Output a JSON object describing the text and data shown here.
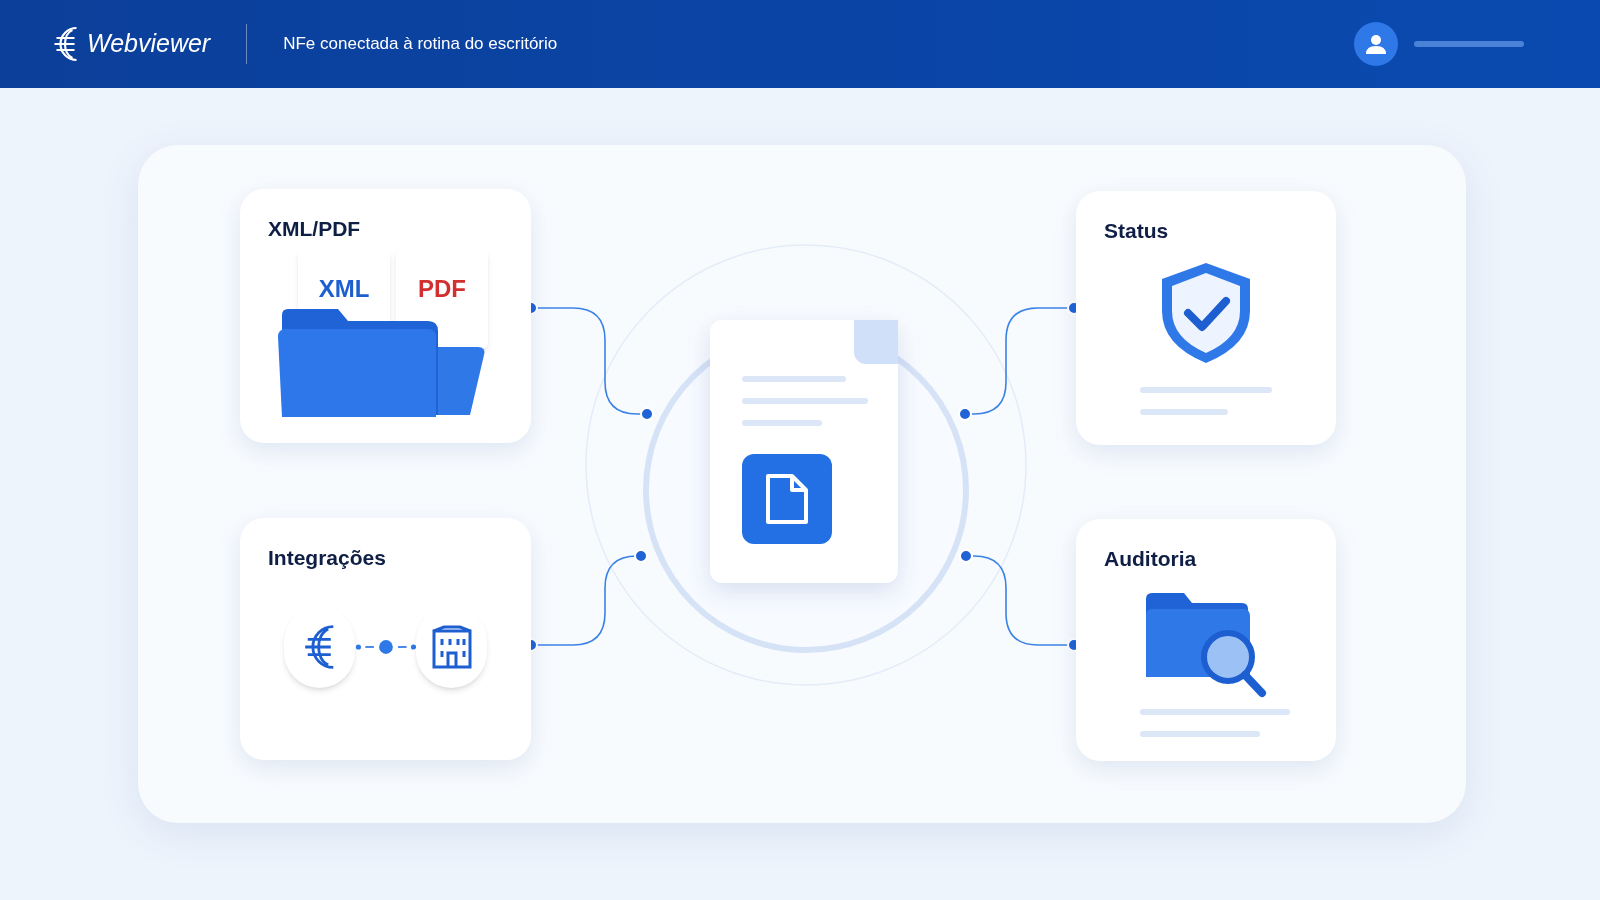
{
  "header": {
    "logo_text": "Webviewer",
    "subtitle": "NFe conectada à rotina do escritório"
  },
  "left_cards": [
    {
      "title": "XML/PDF",
      "kind": "files",
      "labels": [
        "XML",
        "PDF"
      ]
    },
    {
      "title": "Integrações",
      "kind": "integrations"
    }
  ],
  "right_cards": [
    {
      "title": "Status",
      "kind": "status"
    },
    {
      "title": "Auditoria",
      "kind": "audit"
    }
  ]
}
